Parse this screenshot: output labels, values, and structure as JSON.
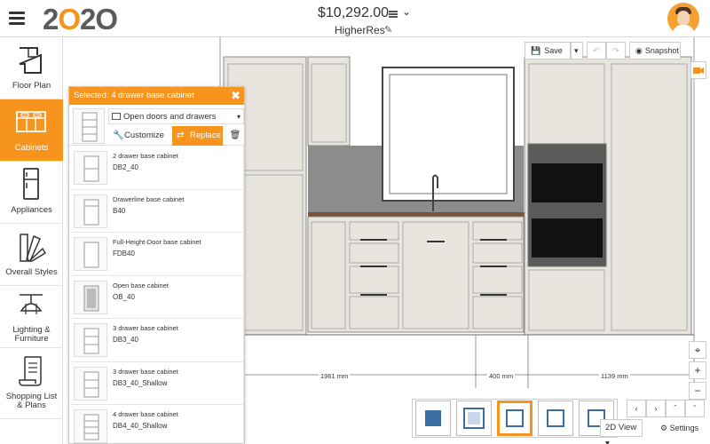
{
  "app": {
    "logo_a": "2",
    "logo_b": "O",
    "logo_c": "2",
    "logo_d": "O",
    "price": "$10,292.00",
    "project": "HigherRes"
  },
  "sidebar": {
    "items": [
      {
        "label": "Floor Plan"
      },
      {
        "label": "Cabinets"
      },
      {
        "label": "Appliances"
      },
      {
        "label": "Overall Styles"
      },
      {
        "label_line1": "Lighting &",
        "label_line2": "Furniture"
      },
      {
        "label_line1": "Shopping List",
        "label_line2": "& Plans"
      }
    ]
  },
  "toolbar": {
    "save_label": "Save",
    "snapshot_label": "Snapshot"
  },
  "panel": {
    "title": "Selected: 4 drawer base cabinet",
    "option": "Open doors and drawers",
    "customize_label": "Customize",
    "replace_label": "Replace",
    "items": [
      {
        "name": "2 drawer base cabinet",
        "code": "DB2_40"
      },
      {
        "name": "Drawerline base cabinet",
        "code": "B40"
      },
      {
        "name": "Full-Height-Door base cabinet",
        "code": "FDB40"
      },
      {
        "name": "Open base cabinet",
        "code": "OB_40"
      },
      {
        "name": "3 drawer base cabinet",
        "code": "DB3_40"
      },
      {
        "name": "3 drawer base cabinet",
        "code": "DB3_40_Shallow"
      },
      {
        "name": "4 drawer base cabinet",
        "code": "DB4_40_Shallow"
      }
    ]
  },
  "dimensions": {
    "d1": "1961 mm",
    "d2": "400 mm",
    "d3": "1139 mm"
  },
  "view": {
    "mode": "2D View",
    "settings_label": "Settings"
  },
  "colors": {
    "accent": "#f7941d",
    "countertop": "#8a8a8a",
    "cabinet": "#e8e5df"
  }
}
